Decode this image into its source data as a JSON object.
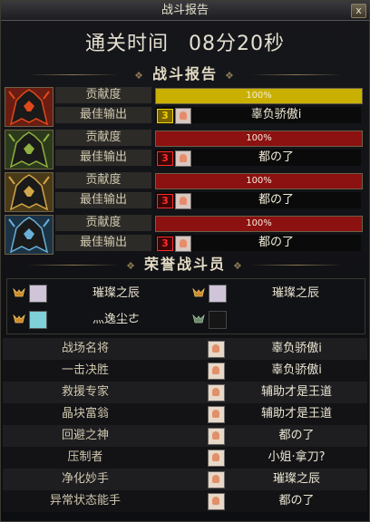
{
  "window": {
    "title": "战斗报告",
    "close": "x"
  },
  "clear": {
    "label": "通关时间",
    "time": "08分20秒"
  },
  "section_report": "战斗报告",
  "section_honor": "荣誉战斗员",
  "row_labels": {
    "contribution": "贡献度",
    "best_output": "最佳输出"
  },
  "players": [
    {
      "icon": "red-flame-helmet-icon",
      "contribution_text": "100%",
      "contribution_level": 1.0,
      "bar_color": "#c9b000",
      "rank": "3",
      "rank_color": "#f2d200",
      "rank_bg": "#7a6400",
      "best_name": "辜负骄傲i"
    },
    {
      "icon": "green-spiked-helmet-icon",
      "contribution_text": "100%",
      "contribution_level": 1.0,
      "bar_color": "#8c1111",
      "rank": "3",
      "rank_color": "#ff2a2a",
      "rank_bg": "#3a0606",
      "best_name": "都の了"
    },
    {
      "icon": "golden-horned-helmet-icon",
      "contribution_text": "100%",
      "contribution_level": 1.0,
      "bar_color": "#8c1111",
      "rank": "3",
      "rank_color": "#ff2a2a",
      "rank_bg": "#3a0606",
      "best_name": "都の了"
    },
    {
      "icon": "blue-ice-helmet-icon",
      "contribution_text": "100%",
      "contribution_level": 1.0,
      "bar_color": "#8c1111",
      "rank": "3",
      "rank_color": "#ff2a2a",
      "rank_bg": "#3a0606",
      "best_name": "都の了"
    }
  ],
  "honor": [
    {
      "name": "璀璨之辰",
      "avatar": "portrait-icon"
    },
    {
      "name": "璀璨之辰",
      "avatar": "portrait-icon"
    },
    {
      "name": "灬逸尘ㄜ",
      "avatar": "portrait-icon"
    },
    {
      "name": "",
      "avatar": "empty-slot-icon"
    }
  ],
  "titles": [
    {
      "title": "战场名将",
      "player": "辜负骄傲i"
    },
    {
      "title": "一击决胜",
      "player": "辜负骄傲i"
    },
    {
      "title": "救援专家",
      "player": "辅助才是王道"
    },
    {
      "title": "晶块富翁",
      "player": "辅助才是王道"
    },
    {
      "title": "回避之神",
      "player": "都の了"
    },
    {
      "title": "压制者",
      "player": "小姐·拿刀?"
    },
    {
      "title": "净化妙手",
      "player": "璀璨之辰"
    },
    {
      "title": "异常状态能手",
      "player": "都の了"
    }
  ]
}
